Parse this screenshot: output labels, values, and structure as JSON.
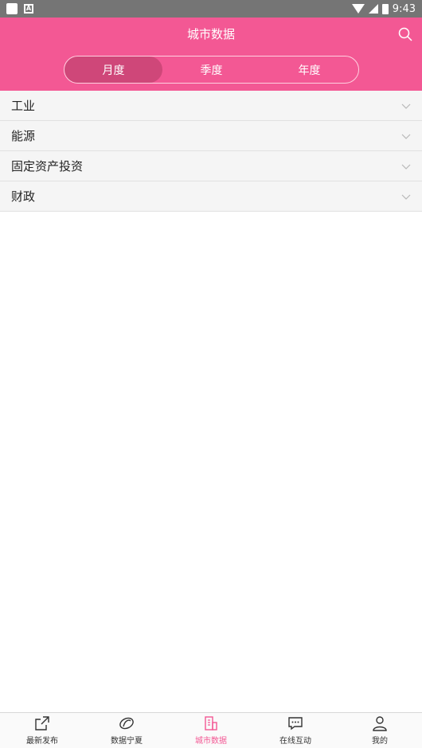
{
  "status_bar": {
    "time": "9:43"
  },
  "header": {
    "title": "城市数据",
    "segments": [
      {
        "label": "月度",
        "active": true
      },
      {
        "label": "季度",
        "active": false
      },
      {
        "label": "年度",
        "active": false
      }
    ]
  },
  "list": {
    "items": [
      {
        "label": "工业"
      },
      {
        "label": "能源"
      },
      {
        "label": "固定资产投资"
      },
      {
        "label": "财政"
      }
    ]
  },
  "tabbar": {
    "items": [
      {
        "label": "最新发布",
        "icon": "share-icon",
        "active": false
      },
      {
        "label": "数据宁夏",
        "icon": "logo-icon",
        "active": false
      },
      {
        "label": "城市数据",
        "icon": "building-icon",
        "active": true
      },
      {
        "label": "在线互动",
        "icon": "chat-icon",
        "active": false
      },
      {
        "label": "我的",
        "icon": "person-icon",
        "active": false
      }
    ]
  },
  "colors": {
    "accent": "#f35894",
    "accent_dark": "#cf4779"
  }
}
